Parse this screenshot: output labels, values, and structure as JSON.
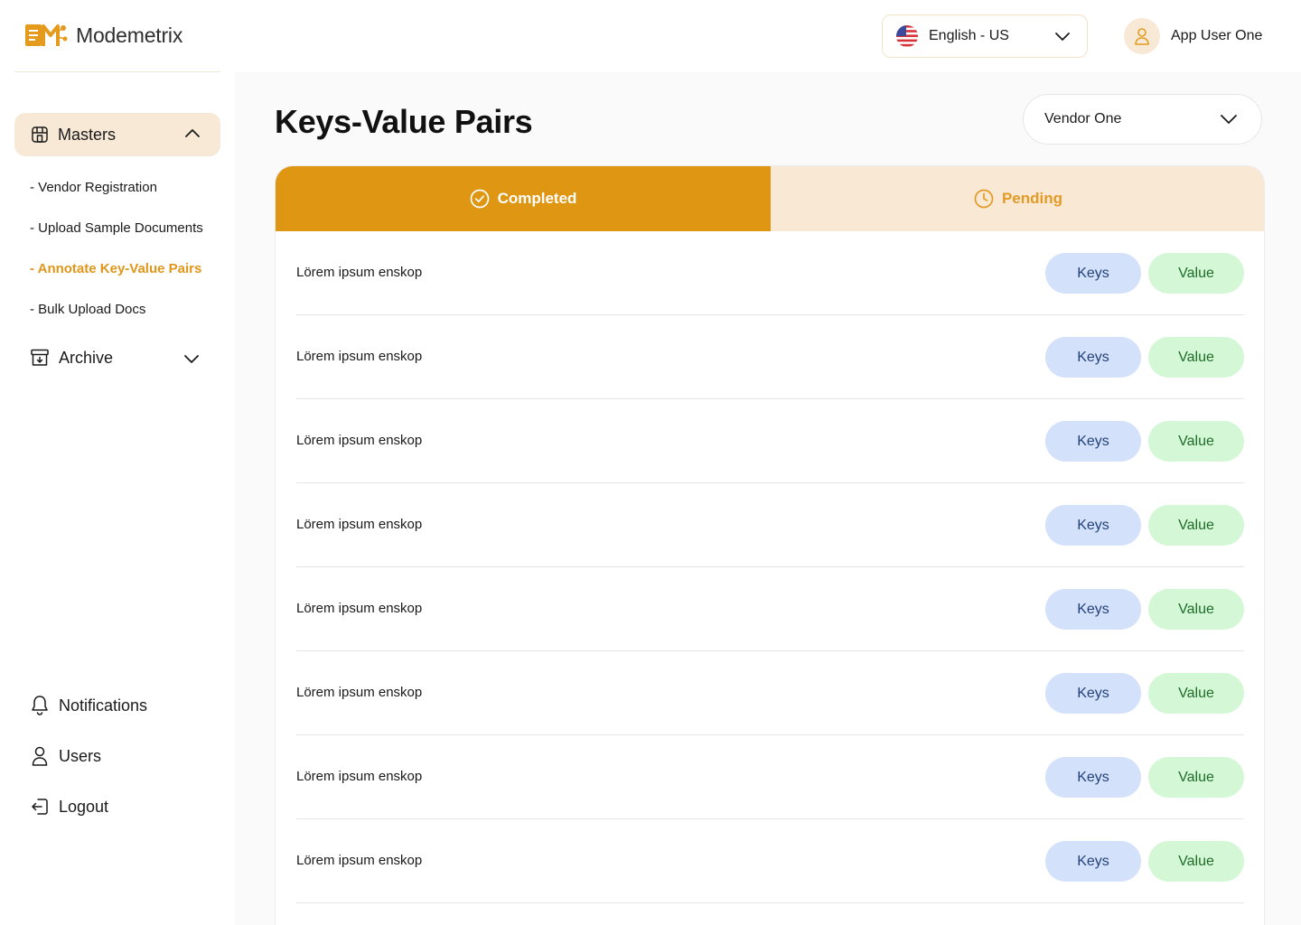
{
  "brand": {
    "name": "Modemetrix"
  },
  "sidebar": {
    "masters": {
      "label": "Masters",
      "icon": "storefront-icon"
    },
    "sub_items": [
      {
        "label": "- Vendor Registration",
        "active": false
      },
      {
        "label": "- Upload Sample Documents",
        "active": false
      },
      {
        "label": "- Annotate Key-Value Pairs",
        "active": true
      },
      {
        "label": "- Bulk Upload Docs",
        "active": false
      }
    ],
    "archive": {
      "label": "Archive",
      "icon": "archive-icon"
    },
    "bottom": [
      {
        "label": "Notifications",
        "icon": "bell-icon"
      },
      {
        "label": "Users",
        "icon": "user-icon"
      },
      {
        "label": "Logout",
        "icon": "logout-icon"
      }
    ]
  },
  "header": {
    "language": {
      "value": "English - US",
      "icon": "us-flag-icon"
    },
    "user": {
      "name": "App User One"
    }
  },
  "main": {
    "title": "Keys-Value Pairs",
    "vendor_select": {
      "value": "Vendor One"
    },
    "tabs": [
      {
        "label": "Completed",
        "selected": true
      },
      {
        "label": "Pending",
        "selected": false
      }
    ],
    "rows": [
      {
        "text": "Lörem ipsum enskop",
        "keys_label": "Keys",
        "value_label": "Value"
      },
      {
        "text": "Lörem ipsum enskop",
        "keys_label": "Keys",
        "value_label": "Value"
      },
      {
        "text": "Lörem ipsum enskop",
        "keys_label": "Keys",
        "value_label": "Value"
      },
      {
        "text": "Lörem ipsum enskop",
        "keys_label": "Keys",
        "value_label": "Value"
      },
      {
        "text": "Lörem ipsum enskop",
        "keys_label": "Keys",
        "value_label": "Value"
      },
      {
        "text": "Lörem ipsum enskop",
        "keys_label": "Keys",
        "value_label": "Value"
      },
      {
        "text": "Lörem ipsum enskop",
        "keys_label": "Keys",
        "value_label": "Value"
      },
      {
        "text": "Lörem ipsum enskop",
        "keys_label": "Keys",
        "value_label": "Value"
      }
    ]
  },
  "colors": {
    "accent": "#df9612",
    "accent_light": "#f8e9d6",
    "keys_bg": "#d3e1fb",
    "value_bg": "#d4f8d6"
  }
}
